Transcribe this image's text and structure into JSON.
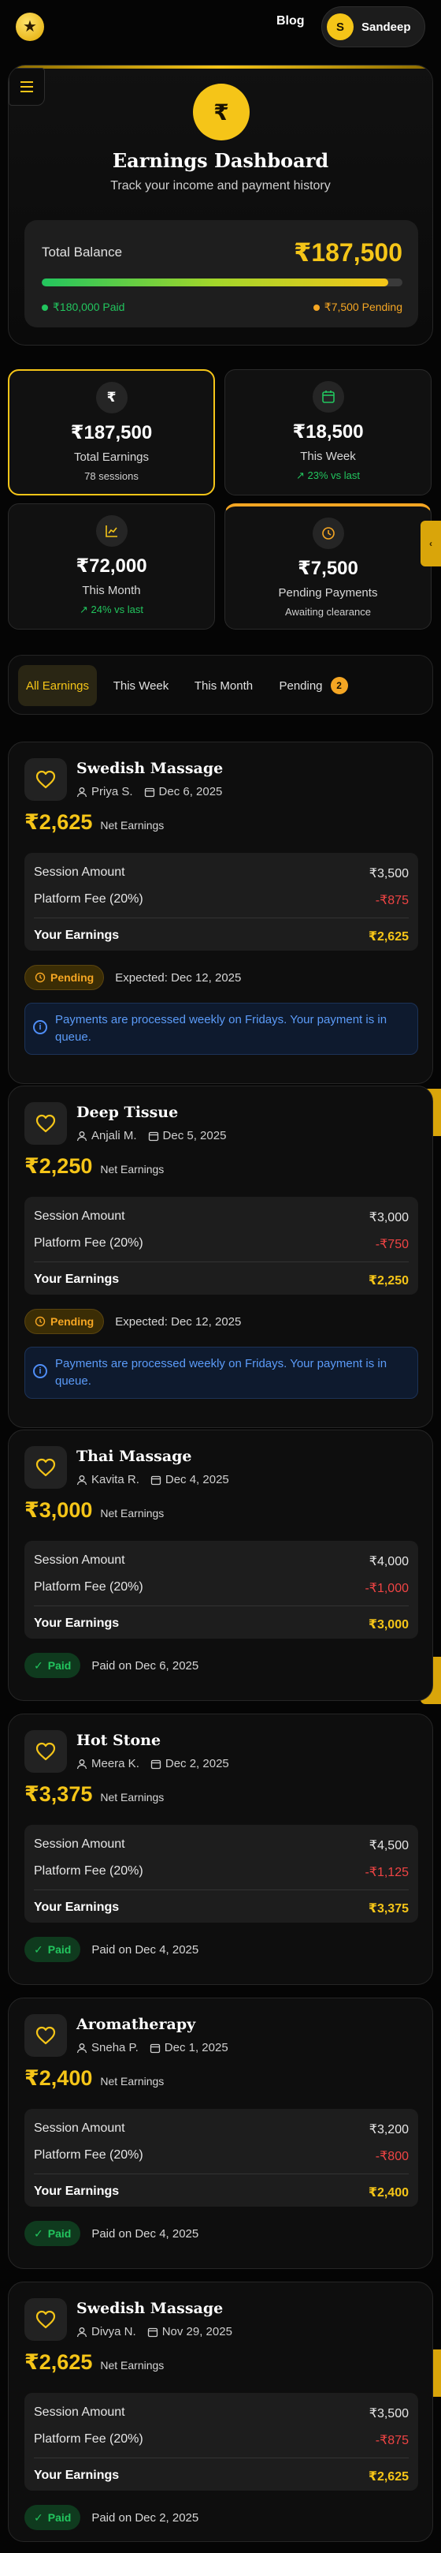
{
  "topbar": {
    "blog": "Blog",
    "user_initial": "S",
    "user_name": "Sandeep"
  },
  "hero": {
    "title": "Earnings Dashboard",
    "subtitle": "Track your income and payment history",
    "currency_symbol": "₹",
    "balance_label": "Total Balance",
    "balance_value": "₹187,500",
    "paid_text": "₹180,000 Paid",
    "pending_text": "₹7,500 Pending",
    "paid_fraction": 0.96
  },
  "stats": [
    {
      "icon": "rupee-icon",
      "value": "₹187,500",
      "label": "Total Earnings",
      "note": "78 sessions"
    },
    {
      "icon": "calendar-icon",
      "value": "₹18,500",
      "label": "This Week",
      "note": "↗ 23% vs last"
    },
    {
      "icon": "chart-icon",
      "value": "₹72,000",
      "label": "This Month",
      "note": "↗ 24% vs last"
    },
    {
      "icon": "clock-icon",
      "value": "₹7,500",
      "label": "Pending Payments",
      "note": "Awaiting clearance"
    }
  ],
  "filters": {
    "all": "All Earnings",
    "week": "This Week",
    "month": "This Month",
    "pending": "Pending",
    "pending_count": "2"
  },
  "labels": {
    "net": "Net Earnings",
    "session_amount": "Session Amount",
    "platform_fee": "Platform Fee (20%)",
    "your_earnings": "Your Earnings",
    "notice": "Payments are processed weekly on Fridays. Your payment is in queue."
  },
  "sessions": [
    {
      "title": "Swedish Massage",
      "client": "Priya S.",
      "date": "Dec 6, 2025",
      "net": "₹2,625",
      "amount": "₹3,500",
      "fee": "-₹875",
      "earnings": "₹2,625",
      "status": "Pending",
      "status_text": "Expected: Dec 12, 2025"
    },
    {
      "title": "Deep Tissue",
      "client": "Anjali M.",
      "date": "Dec 5, 2025",
      "net": "₹2,250",
      "amount": "₹3,000",
      "fee": "-₹750",
      "earnings": "₹2,250",
      "status": "Pending",
      "status_text": "Expected: Dec 12, 2025"
    },
    {
      "title": "Thai Massage",
      "client": "Kavita R.",
      "date": "Dec 4, 2025",
      "net": "₹3,000",
      "amount": "₹4,000",
      "fee": "-₹1,000",
      "earnings": "₹3,000",
      "status": "Paid",
      "status_text": "Paid on Dec 6, 2025"
    },
    {
      "title": "Hot Stone",
      "client": "Meera K.",
      "date": "Dec 2, 2025",
      "net": "₹3,375",
      "amount": "₹4,500",
      "fee": "-₹1,125",
      "earnings": "₹3,375",
      "status": "Paid",
      "status_text": "Paid on Dec 4, 2025"
    },
    {
      "title": "Aromatherapy",
      "client": "Sneha P.",
      "date": "Dec 1, 2025",
      "net": "₹2,400",
      "amount": "₹3,200",
      "fee": "-₹800",
      "earnings": "₹2,400",
      "status": "Paid",
      "status_text": "Paid on Dec 4, 2025"
    },
    {
      "title": "Swedish Massage",
      "client": "Divya N.",
      "date": "Nov 29, 2025",
      "net": "₹2,625",
      "amount": "₹3,500",
      "fee": "-₹875",
      "earnings": "₹2,625",
      "status": "Paid",
      "status_text": "Paid on Dec 2, 2025"
    }
  ],
  "side_tab_glyph": "‹"
}
